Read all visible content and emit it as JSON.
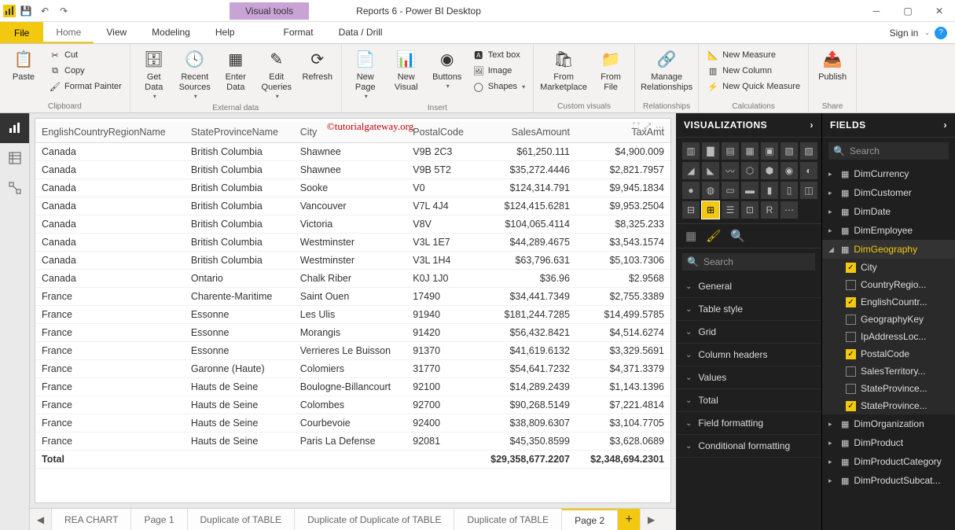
{
  "title": "Reports 6 - Power BI Desktop",
  "visual_tools_label": "Visual tools",
  "signin": "Sign in",
  "menu": {
    "file": "File",
    "home": "Home",
    "view": "View",
    "modeling": "Modeling",
    "help": "Help",
    "format": "Format",
    "datadrill": "Data / Drill"
  },
  "ribbon": {
    "clipboard": {
      "label": "Clipboard",
      "paste": "Paste",
      "cut": "Cut",
      "copy": "Copy",
      "painter": "Format Painter"
    },
    "external": {
      "label": "External data",
      "get": "Get Data",
      "recent": "Recent Sources",
      "enter": "Enter Data",
      "edit": "Edit Queries",
      "refresh": "Refresh"
    },
    "insert": {
      "label": "Insert",
      "newpage": "New Page",
      "newvisual": "New Visual",
      "buttons": "Buttons",
      "textbox": "Text box",
      "image": "Image",
      "shapes": "Shapes"
    },
    "custom": {
      "label": "Custom visuals",
      "market": "From Marketplace",
      "file": "From File"
    },
    "rel": {
      "label": "Relationships",
      "manage": "Manage Relationships"
    },
    "calc": {
      "label": "Calculations",
      "measure": "New Measure",
      "column": "New Column",
      "quick": "New Quick Measure"
    },
    "share": {
      "label": "Share",
      "publish": "Publish"
    }
  },
  "watermark": "©tutorialgateway.org",
  "columns": [
    "EnglishCountryRegionName",
    "StateProvinceName",
    "City",
    "PostalCode",
    "SalesAmount",
    "TaxAmt"
  ],
  "rows": [
    [
      "Canada",
      "British Columbia",
      "Shawnee",
      "V9B 2C3",
      "$61,250.111",
      "$4,900.009"
    ],
    [
      "Canada",
      "British Columbia",
      "Shawnee",
      "V9B 5T2",
      "$35,272.4446",
      "$2,821.7957"
    ],
    [
      "Canada",
      "British Columbia",
      "Sooke",
      "V0",
      "$124,314.791",
      "$9,945.1834"
    ],
    [
      "Canada",
      "British Columbia",
      "Vancouver",
      "V7L 4J4",
      "$124,415.6281",
      "$9,953.2504"
    ],
    [
      "Canada",
      "British Columbia",
      "Victoria",
      "V8V",
      "$104,065.4114",
      "$8,325.233"
    ],
    [
      "Canada",
      "British Columbia",
      "Westminster",
      "V3L 1E7",
      "$44,289.4675",
      "$3,543.1574"
    ],
    [
      "Canada",
      "British Columbia",
      "Westminster",
      "V3L 1H4",
      "$63,796.631",
      "$5,103.7306"
    ],
    [
      "Canada",
      "Ontario",
      "Chalk Riber",
      "K0J 1J0",
      "$36.96",
      "$2.9568"
    ],
    [
      "France",
      "Charente-Maritime",
      "Saint Ouen",
      "17490",
      "$34,441.7349",
      "$2,755.3389"
    ],
    [
      "France",
      "Essonne",
      "Les Ulis",
      "91940",
      "$181,244.7285",
      "$14,499.5785"
    ],
    [
      "France",
      "Essonne",
      "Morangis",
      "91420",
      "$56,432.8421",
      "$4,514.6274"
    ],
    [
      "France",
      "Essonne",
      "Verrieres Le Buisson",
      "91370",
      "$41,619.6132",
      "$3,329.5691"
    ],
    [
      "France",
      "Garonne (Haute)",
      "Colomiers",
      "31770",
      "$54,641.7232",
      "$4,371.3379"
    ],
    [
      "France",
      "Hauts de Seine",
      "Boulogne-Billancourt",
      "92100",
      "$14,289.2439",
      "$1,143.1396"
    ],
    [
      "France",
      "Hauts de Seine",
      "Colombes",
      "92700",
      "$90,268.5149",
      "$7,221.4814"
    ],
    [
      "France",
      "Hauts de Seine",
      "Courbevoie",
      "92400",
      "$38,809.6307",
      "$3,104.7705"
    ],
    [
      "France",
      "Hauts de Seine",
      "Paris La Defense",
      "92081",
      "$45,350.8599",
      "$3,628.0689"
    ]
  ],
  "total": {
    "label": "Total",
    "sales": "$29,358,677.2207",
    "tax": "$2,348,694.2301"
  },
  "viz": {
    "header": "VISUALIZATIONS",
    "search": "Search",
    "sections": [
      "General",
      "Table style",
      "Grid",
      "Column headers",
      "Values",
      "Total",
      "Field formatting",
      "Conditional formatting"
    ]
  },
  "fields": {
    "header": "FIELDS",
    "search": "Search",
    "tables": [
      "DimCurrency",
      "DimCustomer",
      "DimDate",
      "DimEmployee"
    ],
    "geo": {
      "name": "DimGeography",
      "cols": [
        {
          "n": "City",
          "c": true
        },
        {
          "n": "CountryRegio...",
          "c": false
        },
        {
          "n": "EnglishCountr...",
          "c": true
        },
        {
          "n": "GeographyKey",
          "c": false
        },
        {
          "n": "IpAddressLoc...",
          "c": false
        },
        {
          "n": "PostalCode",
          "c": true
        },
        {
          "n": "SalesTerritory...",
          "c": false
        },
        {
          "n": "StateProvince...",
          "c": false
        },
        {
          "n": "StateProvince...",
          "c": true
        }
      ]
    },
    "tables2": [
      "DimOrganization",
      "DimProduct",
      "DimProductCategory",
      "DimProductSubcat..."
    ]
  },
  "tabs": [
    "REA CHART",
    "Page 1",
    "Duplicate of TABLE",
    "Duplicate of Duplicate of TABLE",
    "Duplicate of TABLE",
    "Page 2"
  ]
}
